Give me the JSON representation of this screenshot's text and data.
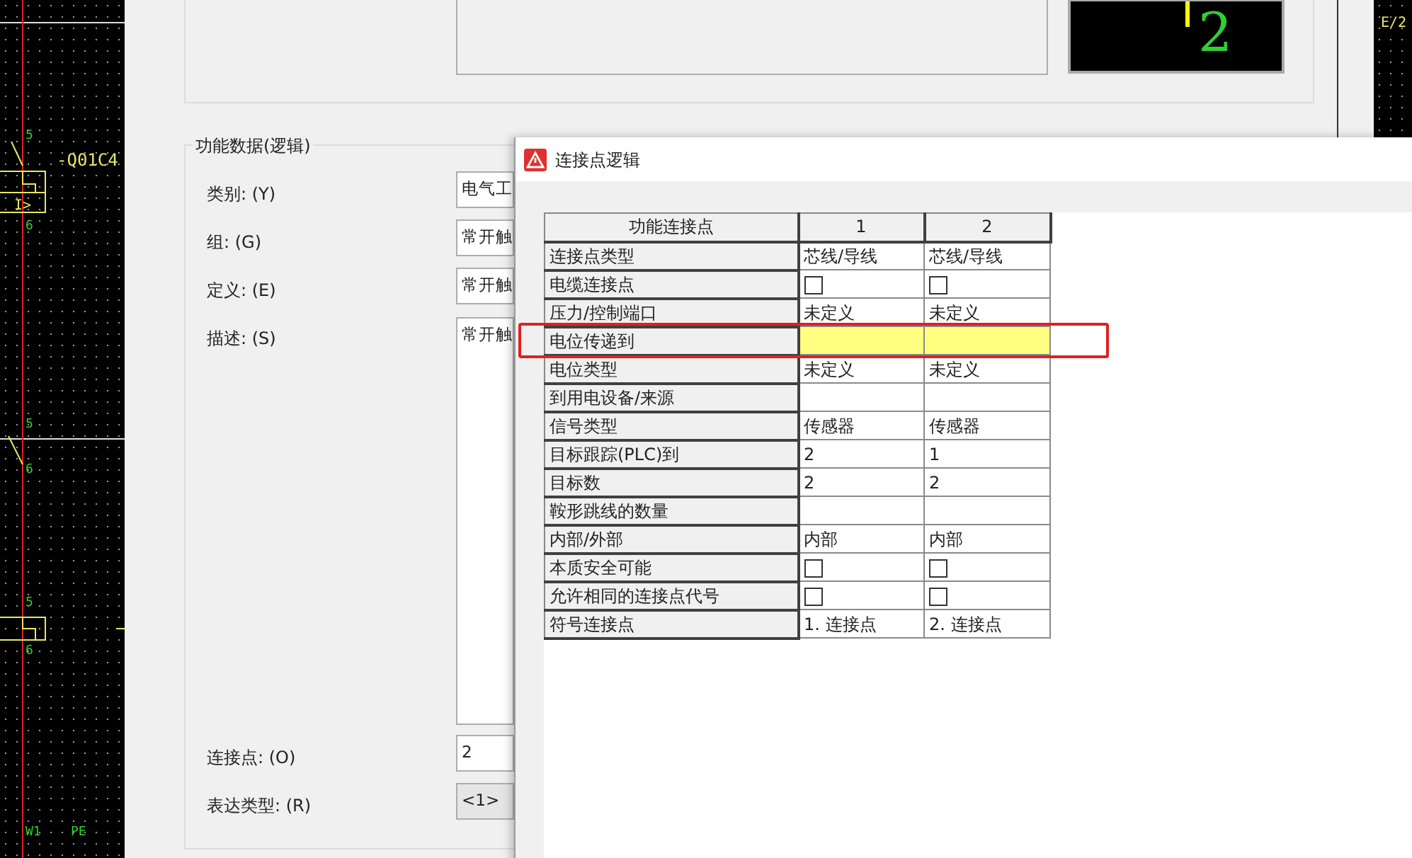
{
  "schematic": {
    "labels": [
      {
        "text": "5",
        "kind": "pin"
      },
      {
        "text": "-Q01C4",
        "kind": "tag"
      },
      {
        "text": "I>",
        "kind": "symbol"
      },
      {
        "text": "6",
        "kind": "pin"
      },
      {
        "text": "5",
        "kind": "pin"
      },
      {
        "text": "6",
        "kind": "pin"
      },
      {
        "text": "5",
        "kind": "pin"
      },
      {
        "text": "6",
        "kind": "pin"
      },
      {
        "text": "W1",
        "kind": "pin"
      },
      {
        "text": "PE",
        "kind": "pin"
      }
    ]
  },
  "preview": {
    "text": "2"
  },
  "right_canvas": {
    "text": "E/2"
  },
  "function_data": {
    "title": "功能数据(逻辑)",
    "fields": [
      {
        "label": "类别: (Y)",
        "value": "电气工",
        "kind": "input"
      },
      {
        "label": "组: (G)",
        "value": "常开触",
        "kind": "input"
      },
      {
        "label": "定义: (E)",
        "value": "常开触",
        "kind": "input"
      },
      {
        "label": "描述: (S)",
        "value": "常开触",
        "kind": "textarea"
      },
      {
        "label": "连接点: (O)",
        "value": "2",
        "kind": "input"
      },
      {
        "label": "表达类型: (R)",
        "value": "<1>",
        "kind": "select"
      }
    ]
  },
  "dialog": {
    "title": "连接点逻辑",
    "table": {
      "columns": [
        "功能连接点",
        "1",
        "2"
      ],
      "rows": [
        {
          "label": "连接点类型",
          "kind": "text",
          "cells": [
            "芯线/导线",
            "芯线/导线"
          ],
          "selected": false
        },
        {
          "label": "电缆连接点",
          "kind": "checkbox",
          "cells": [
            {
              "checked": false
            },
            {
              "checked": false
            }
          ],
          "selected": false
        },
        {
          "label": "压力/控制端口",
          "kind": "text",
          "cells": [
            "未定义",
            "未定义"
          ],
          "selected": false
        },
        {
          "label": "电位传递到",
          "kind": "empty",
          "selected": true
        },
        {
          "label": "电位类型",
          "kind": "text",
          "cells": [
            "未定义",
            "未定义"
          ],
          "selected": false
        },
        {
          "label": "到用电设备/来源",
          "kind": "empty",
          "selected": false
        },
        {
          "label": "信号类型",
          "kind": "text",
          "cells": [
            "传感器",
            "传感器"
          ],
          "selected": false
        },
        {
          "label": "目标跟踪(PLC)到",
          "kind": "text",
          "cells": [
            "2",
            "1"
          ],
          "selected": false
        },
        {
          "label": "目标数",
          "kind": "text",
          "cells": [
            "2",
            "2"
          ],
          "selected": false
        },
        {
          "label": "鞍形跳线的数量",
          "kind": "empty",
          "selected": false
        },
        {
          "label": "内部/外部",
          "kind": "text",
          "cells": [
            "内部",
            "内部"
          ],
          "selected": false
        },
        {
          "label": "本质安全可能",
          "kind": "checkbox",
          "cells": [
            {
              "checked": false
            },
            {
              "checked": false
            }
          ],
          "selected": false
        },
        {
          "label": "允许相同的连接点代号",
          "kind": "checkbox",
          "cells": [
            {
              "checked": false
            },
            {
              "checked": false
            }
          ],
          "selected": false
        },
        {
          "label": "符号连接点",
          "kind": "text",
          "cells": [
            "1. 连接点",
            "2. 连接点"
          ],
          "selected": false
        }
      ]
    }
  }
}
